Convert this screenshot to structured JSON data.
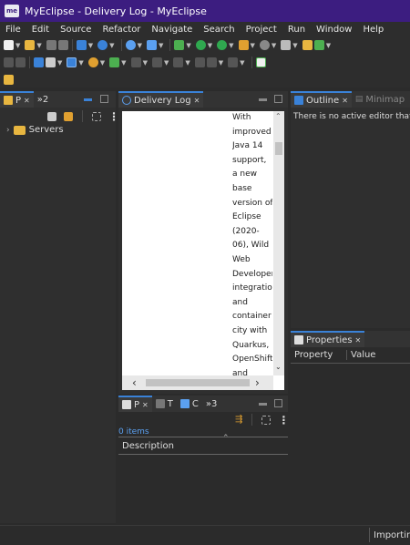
{
  "window": {
    "title": "MyEclipse - Delivery Log - MyEclipse",
    "logo_text": "me"
  },
  "menu": [
    "File",
    "Edit",
    "Source",
    "Refactor",
    "Navigate",
    "Search",
    "Project",
    "Run",
    "Window",
    "Help"
  ],
  "left_panel": {
    "tab_label": "P",
    "overflow_label": "»2",
    "tree": [
      {
        "label": "Servers",
        "icon": "folder-icon",
        "expanded": false
      }
    ]
  },
  "editor": {
    "tab_label": "Delivery Log",
    "content_lines": [
      "With",
      "improved",
      "Java 14",
      "support,",
      "a new",
      "base",
      "version of",
      "Eclipse",
      "(2020-",
      "06), Wild",
      "Web",
      "Developer",
      "integration",
      "and",
      "container",
      "city with",
      "Quarkus,",
      "OpenShift",
      "and"
    ]
  },
  "outline": {
    "tab_label": "Outline",
    "minimap_label": "Minimap",
    "message": "There is no active editor that pr"
  },
  "bottom_panel": {
    "tabs": [
      {
        "label": "P",
        "icon": "problems-icon"
      },
      {
        "label": "T",
        "icon": "tasks-icon"
      },
      {
        "label": "C",
        "icon": "console-icon"
      },
      {
        "label": "»3",
        "icon": ""
      }
    ],
    "items_count": "0 items",
    "column_header": "Description"
  },
  "properties": {
    "tab_label": "Properties",
    "columns": [
      "Property",
      "Value"
    ]
  },
  "status": {
    "text": "Importing"
  },
  "colors": {
    "title_bar": "#3c1d80",
    "accent": "#3a82d8"
  }
}
